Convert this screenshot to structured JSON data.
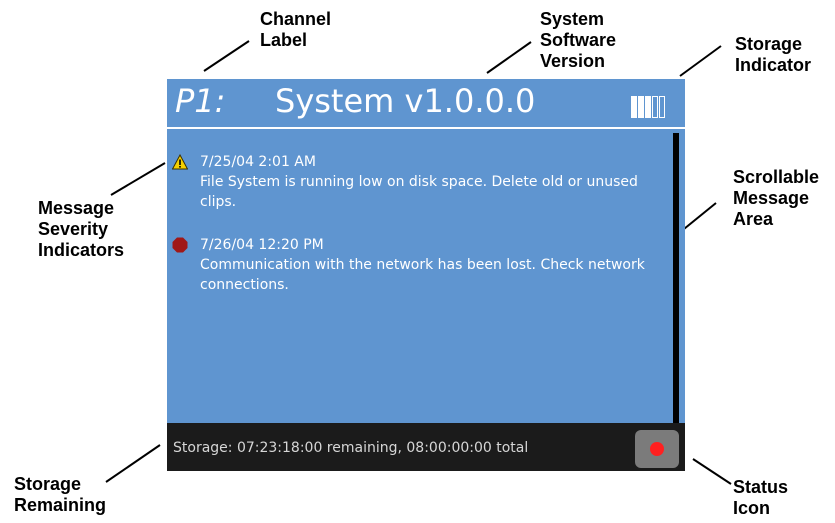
{
  "callouts": {
    "channel_label": [
      "Channel",
      "Label"
    ],
    "system_software_version": [
      "System",
      "Software",
      "Version"
    ],
    "storage_indicator": [
      "Storage",
      "Indicator"
    ],
    "message_severity_indicators": [
      "Message",
      "Severity",
      "Indicators"
    ],
    "scrollable_message_area": [
      "Scrollable",
      "Message",
      "Area"
    ],
    "storage_remaining": [
      "Storage",
      "Remaining"
    ],
    "status_icon": [
      "Status",
      "Icon"
    ]
  },
  "device": {
    "channel": "P1:",
    "version": "System v1.0.0.0",
    "storage_level": 0.6,
    "messages": [
      {
        "severity": "warning",
        "icon": "warning-triangle-icon",
        "time": "7/25/04 2:01 AM",
        "text": "File System is running low on disk space. Delete old or unused clips."
      },
      {
        "severity": "error",
        "icon": "error-octagon-icon",
        "time": "7/26/04 12:20 PM",
        "text": "Communication with the network has been lost. Check network connections."
      }
    ],
    "footer": "Storage: 07:23:18:00 remaining, 08:00:00:00 total",
    "status_icon": "record-icon"
  },
  "colors": {
    "screen_bg": "#5f95d0",
    "footer_bg": "#1b1b1b",
    "status_red": "#ff2020",
    "warning_yellow": "#f5d000",
    "error_red": "#a01818"
  }
}
